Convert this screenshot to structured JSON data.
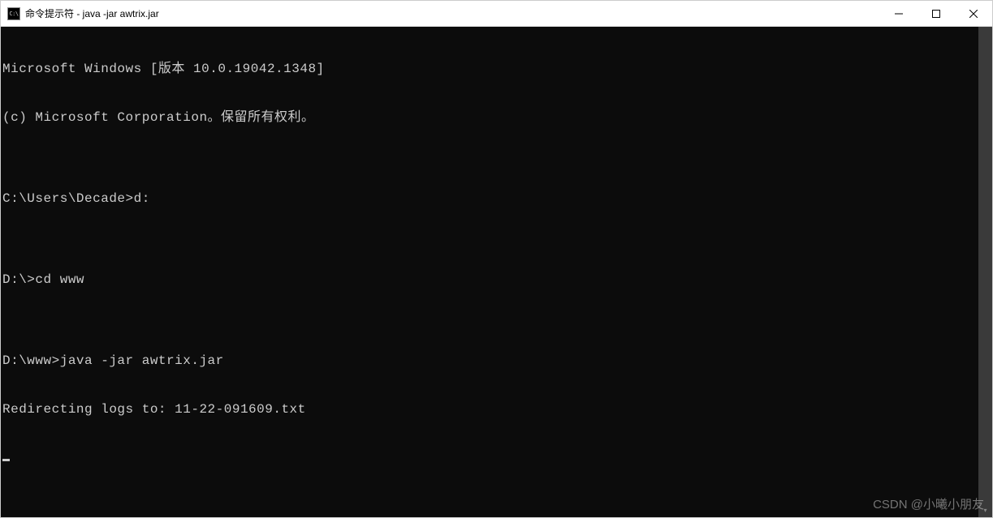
{
  "titlebar": {
    "icon_label": "C:\\",
    "title": "命令提示符 - java  -jar awtrix.jar"
  },
  "terminal": {
    "lines": [
      "Microsoft Windows [版本 10.0.19042.1348]",
      "(c) Microsoft Corporation。保留所有权利。",
      "",
      "C:\\Users\\Decade>d:",
      "",
      "D:\\>cd www",
      "",
      "D:\\www>java -jar awtrix.jar",
      "Redirecting logs to: 11-22-091609.txt"
    ]
  },
  "watermark": "CSDN @小曦小朋友"
}
